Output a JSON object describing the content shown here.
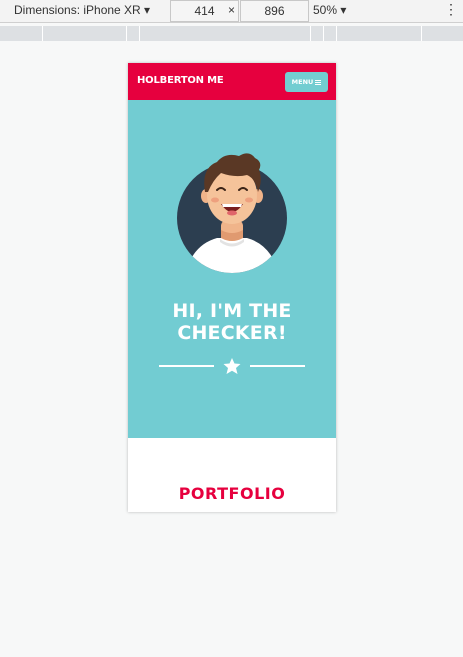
{
  "devtools": {
    "device_label": "Dimensions: iPhone XR ▾",
    "width_value": "414",
    "times": "×",
    "height_value": "896",
    "zoom": "50% ▾",
    "more_icon": "kebab-icon"
  },
  "site": {
    "brand": "HOLBERTON ME",
    "menu_label": "MENU",
    "menu_icon": "hamburger-icon",
    "hero_title": "HI, I'M THE\nCHECKER!",
    "divider_icon": "star-icon",
    "section_title": "PORTFOLIO"
  },
  "colors": {
    "brand_red": "#e6003e",
    "hero_teal": "#72ccd2",
    "avatar_bg": "#2c3e50"
  }
}
